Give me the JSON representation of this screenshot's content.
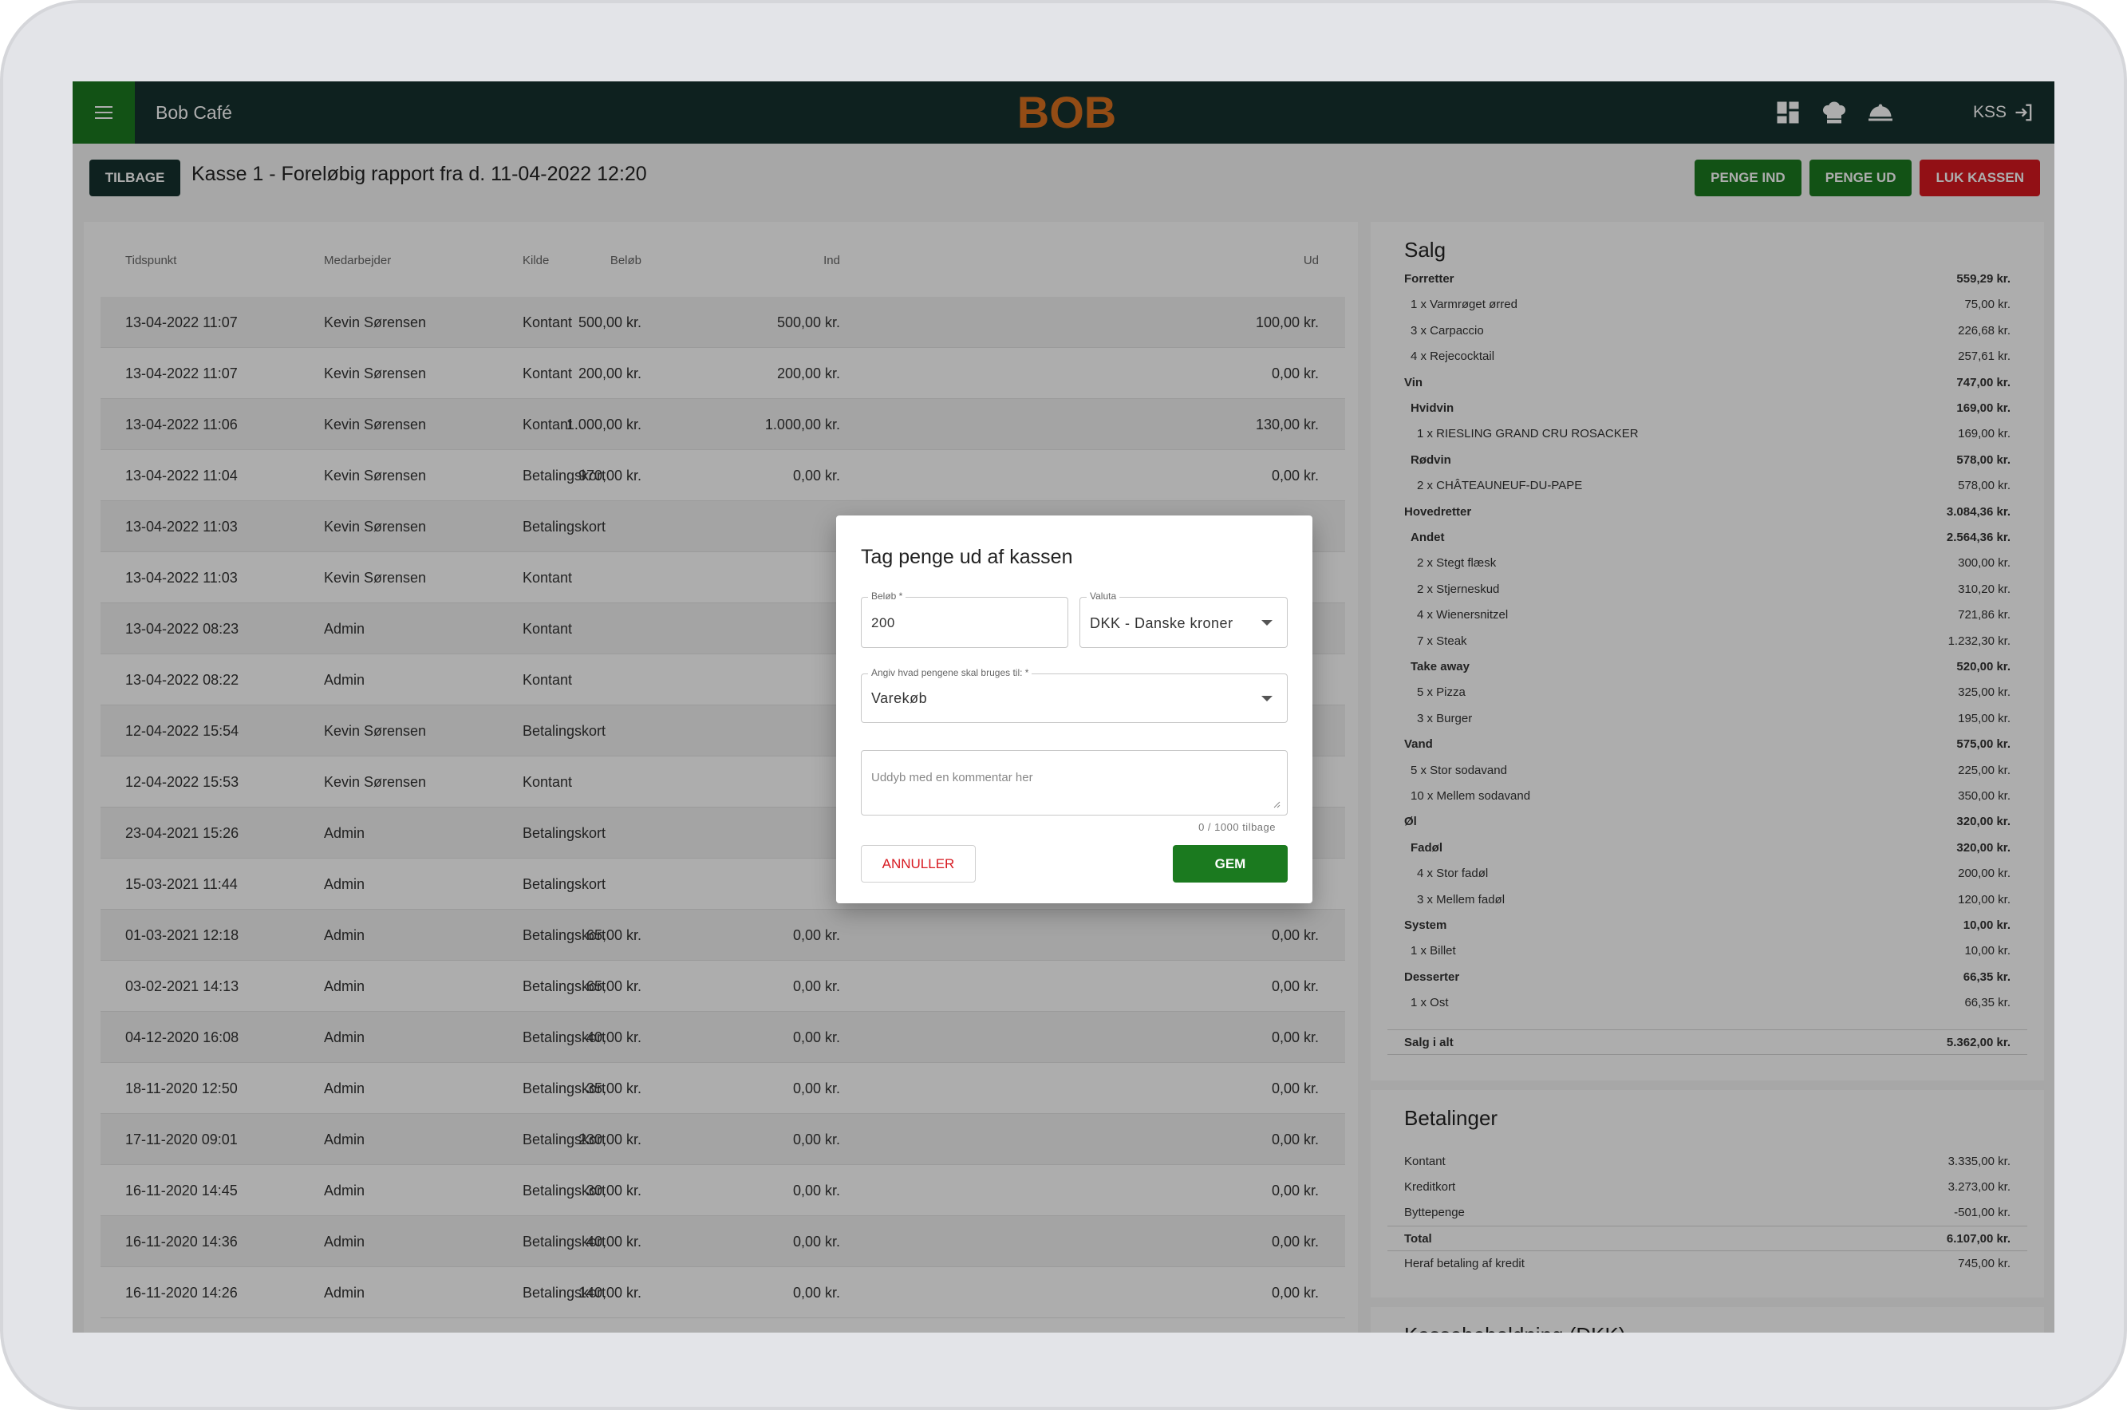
{
  "topbar": {
    "app_name": "Bob Café",
    "logo_text": "BOB",
    "user": "KSS"
  },
  "subheader": {
    "back": "TILBAGE",
    "title": "Kasse 1 - Foreløbig rapport fra d. 11-04-2022 12:20",
    "penge_ind": "PENGE IND",
    "penge_ud": "PENGE UD",
    "luk_kassen": "LUK KASSEN"
  },
  "table": {
    "headers": [
      "Tidspunkt",
      "Medarbejder",
      "Kilde",
      "Beløb",
      "Ind",
      "Ud"
    ],
    "rows": [
      [
        "13-04-2022 11:07",
        "Kevin Sørensen",
        "Kontant",
        "500,00 kr.",
        "500,00 kr.",
        "100,00 kr."
      ],
      [
        "13-04-2022 11:07",
        "Kevin Sørensen",
        "Kontant",
        "200,00 kr.",
        "200,00 kr.",
        "0,00 kr."
      ],
      [
        "13-04-2022 11:06",
        "Kevin Sørensen",
        "Kontant",
        "1.000,00 kr.",
        "1.000,00 kr.",
        "130,00 kr."
      ],
      [
        "13-04-2022 11:04",
        "Kevin Sørensen",
        "Betalingskort",
        "970,00 kr.",
        "0,00 kr.",
        "0,00 kr."
      ],
      [
        "13-04-2022 11:03",
        "Kevin Sørensen",
        "Betalingskort",
        "",
        "",
        ""
      ],
      [
        "13-04-2022 11:03",
        "Kevin Sørensen",
        "Kontant",
        "",
        "",
        ""
      ],
      [
        "13-04-2022 08:23",
        "Admin",
        "Kontant",
        "",
        "",
        ""
      ],
      [
        "13-04-2022 08:22",
        "Admin",
        "Kontant",
        "",
        "",
        ""
      ],
      [
        "12-04-2022 15:54",
        "Kevin Sørensen",
        "Betalingskort",
        "",
        "",
        ""
      ],
      [
        "12-04-2022 15:53",
        "Kevin Sørensen",
        "Kontant",
        "",
        "",
        ""
      ],
      [
        "23-04-2021 15:26",
        "Admin",
        "Betalingskort",
        "",
        "",
        ""
      ],
      [
        "15-03-2021 11:44",
        "Admin",
        "Betalingskort",
        "",
        "",
        ""
      ],
      [
        "01-03-2021 12:18",
        "Admin",
        "Betalingskort",
        "65,00 kr.",
        "0,00 kr.",
        "0,00 kr."
      ],
      [
        "03-02-2021 14:13",
        "Admin",
        "Betalingskort",
        "65,00 kr.",
        "0,00 kr.",
        "0,00 kr."
      ],
      [
        "04-12-2020 16:08",
        "Admin",
        "Betalingskort",
        "40,00 kr.",
        "0,00 kr.",
        "0,00 kr."
      ],
      [
        "18-11-2020 12:50",
        "Admin",
        "Betalingskort",
        "35,00 kr.",
        "0,00 kr.",
        "0,00 kr."
      ],
      [
        "17-11-2020 09:01",
        "Admin",
        "Betalingskort",
        "230,00 kr.",
        "0,00 kr.",
        "0,00 kr."
      ],
      [
        "16-11-2020 14:45",
        "Admin",
        "Betalingskort",
        "30,00 kr.",
        "0,00 kr.",
        "0,00 kr."
      ],
      [
        "16-11-2020 14:36",
        "Admin",
        "Betalingskort",
        "40,00 kr.",
        "0,00 kr.",
        "0,00 kr."
      ],
      [
        "16-11-2020 14:26",
        "Admin",
        "Betalingskort",
        "140,00 kr.",
        "0,00 kr.",
        "0,00 kr."
      ]
    ]
  },
  "salg": {
    "title": "Salg",
    "lines": [
      {
        "label": "Forretter",
        "value": "559,29 kr.",
        "level": 0
      },
      {
        "label": "1 x Varmrøget ørred",
        "value": "75,00 kr.",
        "level": 1
      },
      {
        "label": "3 x Carpaccio",
        "value": "226,68 kr.",
        "level": 1
      },
      {
        "label": "4 x Rejecocktail",
        "value": "257,61 kr.",
        "level": 1
      },
      {
        "label": "Vin",
        "value": "747,00 kr.",
        "level": 0
      },
      {
        "label": "Hvidvin",
        "value": "169,00 kr.",
        "level": 2
      },
      {
        "label": "1 x RIESLING GRAND CRU ROSACKER",
        "value": "169,00 kr.",
        "level": 3
      },
      {
        "label": "Rødvin",
        "value": "578,00 kr.",
        "level": 2
      },
      {
        "label": "2 x CHÂTEAUNEUF-DU-PAPE",
        "value": "578,00 kr.",
        "level": 3
      },
      {
        "label": "Hovedretter",
        "value": "3.084,36 kr.",
        "level": 0
      },
      {
        "label": "Andet",
        "value": "2.564,36 kr.",
        "level": 2
      },
      {
        "label": "2 x Stegt flæsk",
        "value": "300,00 kr.",
        "level": 3
      },
      {
        "label": "2 x Stjerneskud",
        "value": "310,20 kr.",
        "level": 3
      },
      {
        "label": "4 x Wienersnitzel",
        "value": "721,86 kr.",
        "level": 3
      },
      {
        "label": "7 x Steak",
        "value": "1.232,30 kr.",
        "level": 3
      },
      {
        "label": "Take away",
        "value": "520,00 kr.",
        "level": 2
      },
      {
        "label": "5 x Pizza",
        "value": "325,00 kr.",
        "level": 3
      },
      {
        "label": "3 x Burger",
        "value": "195,00 kr.",
        "level": 3
      },
      {
        "label": "Vand",
        "value": "575,00 kr.",
        "level": 0
      },
      {
        "label": "5 x Stor sodavand",
        "value": "225,00 kr.",
        "level": 1
      },
      {
        "label": "10 x Mellem sodavand",
        "value": "350,00 kr.",
        "level": 1
      },
      {
        "label": "Øl",
        "value": "320,00 kr.",
        "level": 0
      },
      {
        "label": "Fadøl",
        "value": "320,00 kr.",
        "level": 2
      },
      {
        "label": "4 x Stor fadøl",
        "value": "200,00 kr.",
        "level": 3
      },
      {
        "label": "3 x Mellem fadøl",
        "value": "120,00 kr.",
        "level": 3
      },
      {
        "label": "System",
        "value": "10,00 kr.",
        "level": 0
      },
      {
        "label": "1 x Billet",
        "value": "10,00 kr.",
        "level": 1
      },
      {
        "label": "Desserter",
        "value": "66,35 kr.",
        "level": 0
      },
      {
        "label": "1 x Ost",
        "value": "66,35 kr.",
        "level": 1
      }
    ],
    "total_label": "Salg i alt",
    "total_value": "5.362,00 kr."
  },
  "betalinger": {
    "title": "Betalinger",
    "lines": [
      {
        "label": "Kontant",
        "value": "3.335,00 kr."
      },
      {
        "label": "Kreditkort",
        "value": "3.273,00 kr."
      },
      {
        "label": "Byttepenge",
        "value": "-501,00 kr."
      }
    ],
    "total_label": "Total",
    "total_value": "6.107,00 kr.",
    "kredit_label": "Heraf betaling af kredit",
    "kredit_value": "745,00 kr."
  },
  "kassebeholdning": {
    "title": "Kassebeholdning (DKK)"
  },
  "dialog": {
    "title": "Tag penge ud af kassen",
    "amount_label": "Beløb *",
    "amount_value": "200",
    "currency_label": "Valuta",
    "currency_value": "DKK - Danske kroner",
    "purpose_label": "Angiv hvad pengene skal bruges til: *",
    "purpose_value": "Varekøb",
    "comment_placeholder": "Uddyb med en kommentar her",
    "counter": "0 / 1000 tilbage",
    "cancel": "ANNULLER",
    "save": "GEM"
  },
  "colors": {
    "topbar": "#15312e",
    "green": "#1b7a1f",
    "red": "#d71920",
    "logo": "#d9701f"
  }
}
